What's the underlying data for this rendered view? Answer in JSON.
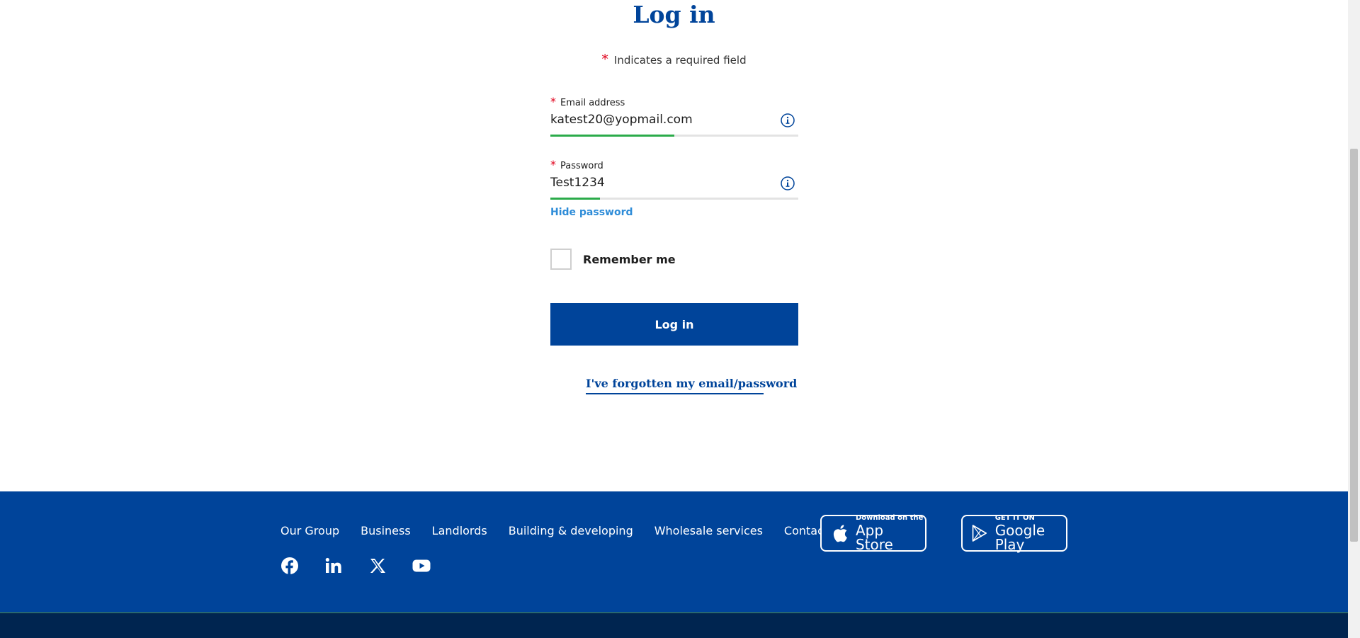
{
  "page": {
    "title": "Log in",
    "required_note": "Indicates a required field",
    "required_marker": "*"
  },
  "form": {
    "email": {
      "label": "Email address",
      "value": "katest20@yopmail.com",
      "progress_fraction": 0.5,
      "info_icon": "info-icon"
    },
    "password": {
      "label": "Password",
      "value": "Test1234",
      "progress_fraction": 0.2,
      "info_icon": "info-icon"
    },
    "hide_password_label": "Hide password",
    "remember_label": "Remember me",
    "remember_checked": false,
    "login_label": "Log in",
    "forgot_label": "I've forgotten my email/password"
  },
  "footer": {
    "nav": [
      "Our Group",
      "Business",
      "Landlords",
      "Building & developing",
      "Wholesale services",
      "Contact us"
    ],
    "social": [
      "facebook-icon",
      "linkedin-icon",
      "x-icon",
      "youtube-icon"
    ],
    "app_store": {
      "small": "Download on the",
      "big": "App Store",
      "icon": "apple-icon"
    },
    "google_play": {
      "small": "GET IT ON",
      "big": "Google Play",
      "icon": "play-icon"
    }
  },
  "colors": {
    "brand": "#00449a",
    "link": "#2e8cd8",
    "required": "#e0001b",
    "progress": "#2bab4a",
    "footer_bottom": "#002550"
  }
}
